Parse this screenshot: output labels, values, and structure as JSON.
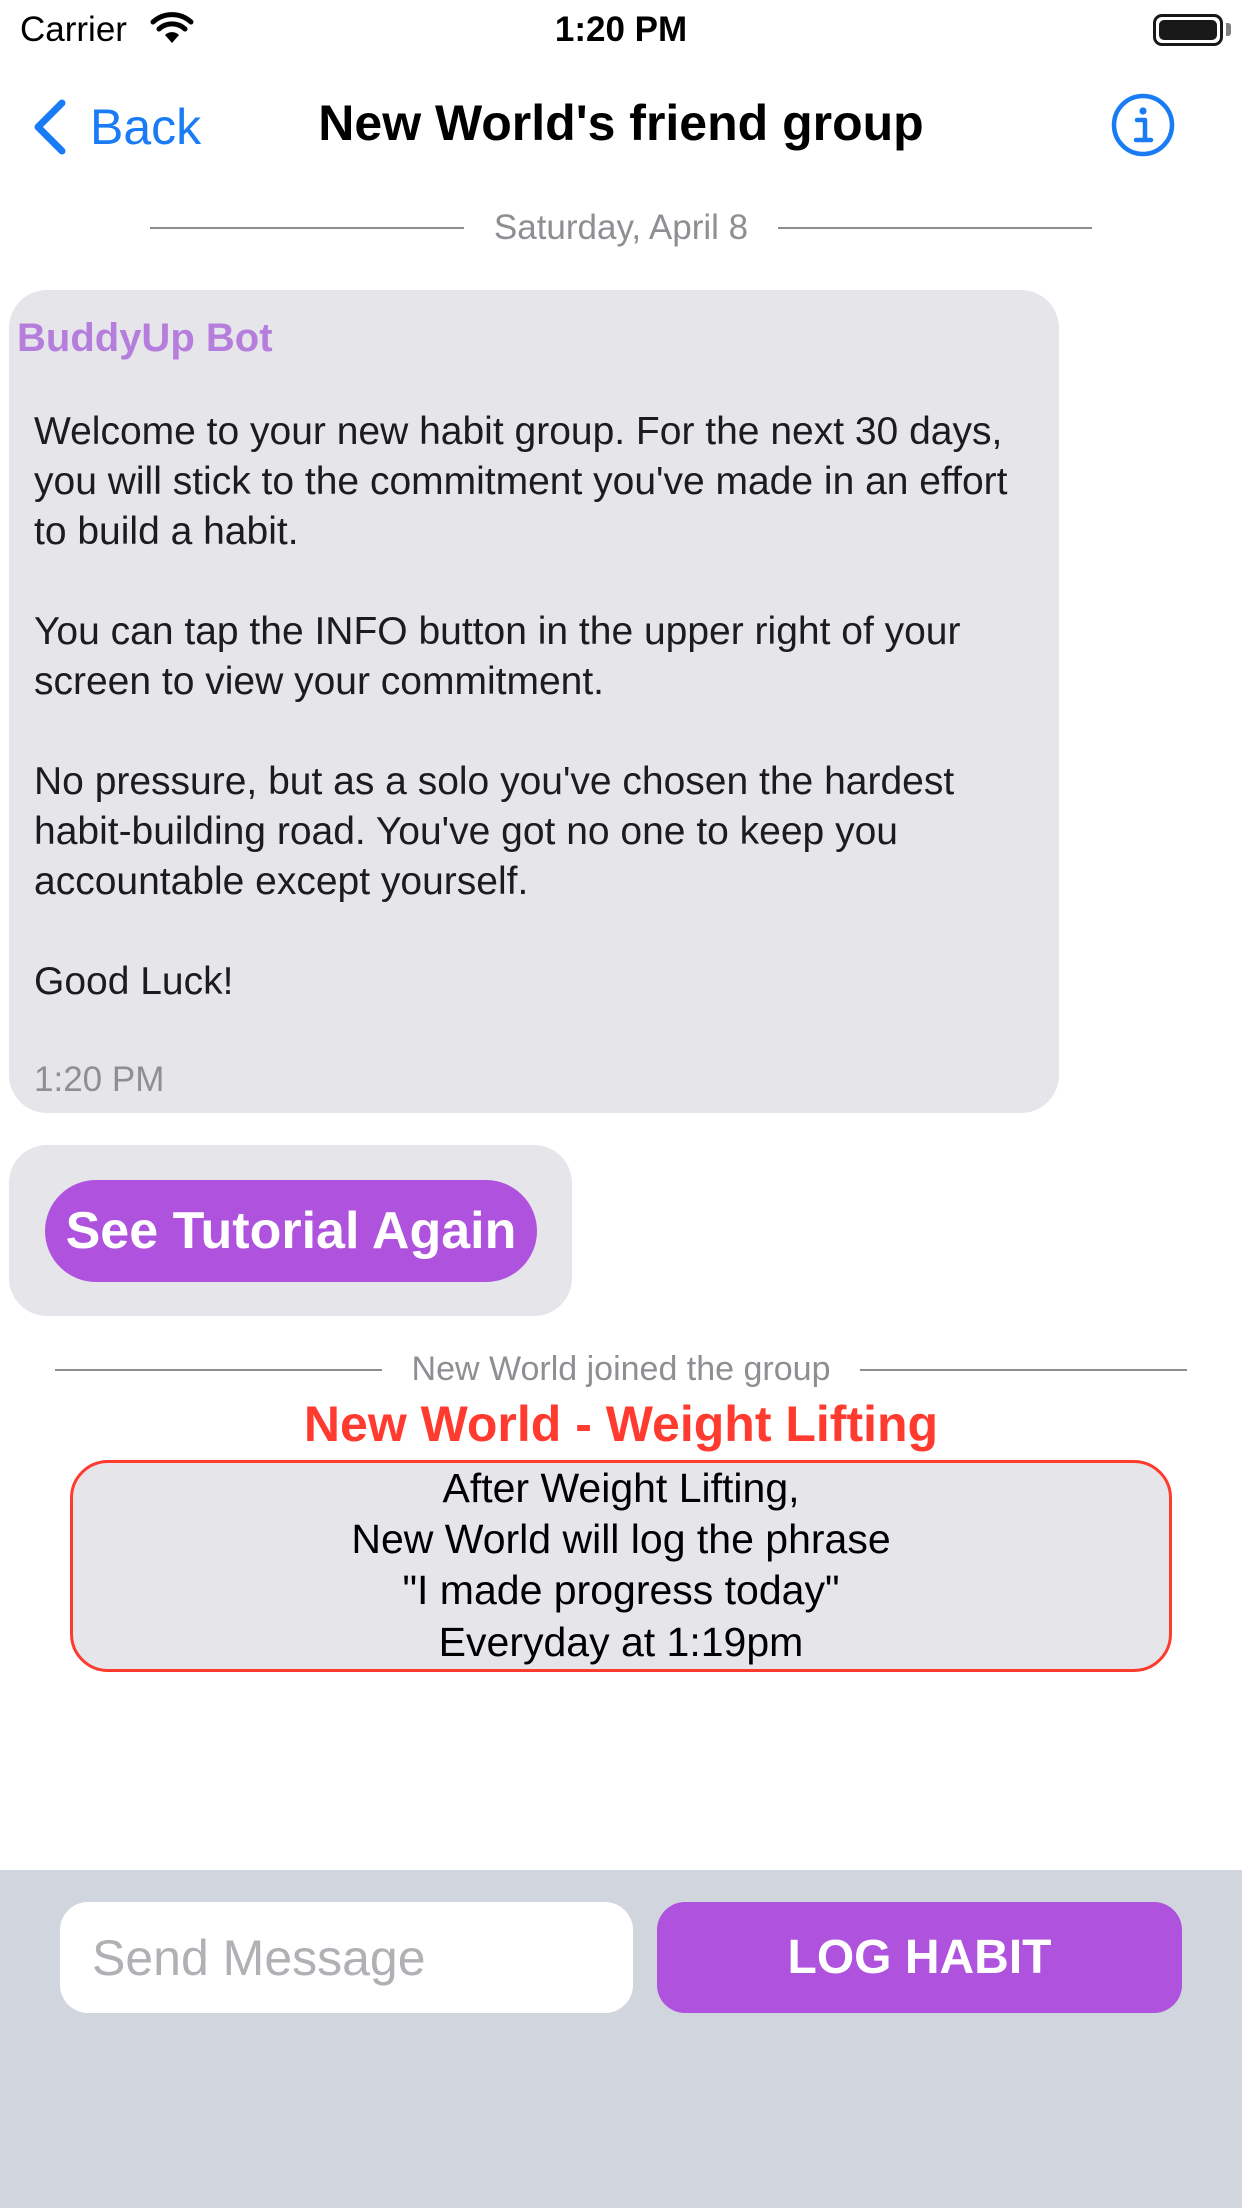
{
  "status_bar": {
    "carrier": "Carrier",
    "time": "1:20 PM"
  },
  "nav": {
    "back_label": "Back",
    "title": "New World's friend group",
    "info_icon": "info-circle-icon"
  },
  "chat": {
    "date_separator": "Saturday, April 8",
    "bot_message": {
      "sender": "BuddyUp Bot",
      "text": "Welcome to your new habit group. For the next 30 days, you will stick to the commitment you've made in an effort to build a habit.\n\nYou can tap the INFO button in the upper right of your screen to view your commitment.\n\nNo pressure, but as a solo you've chosen the hardest habit-building road. You've got no one to keep you accountable except yourself.\n\nGood Luck!",
      "time": "1:20 PM"
    },
    "tutorial_button_label": "See Tutorial Again",
    "joined_separator": "New World joined the group",
    "commitment": {
      "title": "New World - Weight Lifting",
      "lines": [
        "After Weight Lifting,",
        "New World will log the phrase",
        "\"I made progress today\"",
        "Everyday at 1:19pm"
      ]
    }
  },
  "composer": {
    "placeholder": "Send Message",
    "value": "",
    "log_button_label": "LOG HABIT"
  },
  "colors": {
    "accent_purple": "#af52de",
    "bot_name_purple": "#b57edc",
    "link_blue": "#1a7cf5",
    "commitment_red": "#ff3b30",
    "bubble_gray": "#e5e5ea",
    "composer_bg": "#d1d5dd"
  }
}
